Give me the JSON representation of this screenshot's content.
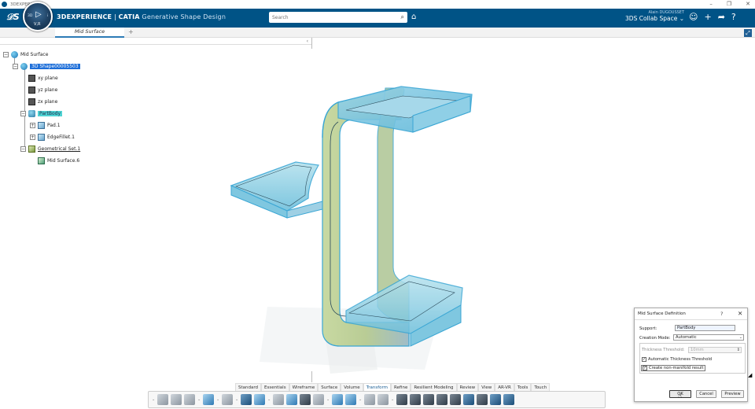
{
  "os": {
    "title": "3DEXPERIENCE",
    "minimize": "–",
    "restore": "❐",
    "close": "✕"
  },
  "header": {
    "brand_main": "3DEXPERIENCE",
    "brand_sep": " | ",
    "brand_product": "CATIA",
    "brand_app": "Generative Shape Design",
    "compass_version": "V,R",
    "search_placeholder": "Search",
    "user_name": "Alain DUGOUSSET",
    "collab_space": "3DS Collab Space",
    "collab_chevron": "⌄",
    "icons": [
      "user-icon",
      "add-icon",
      "share-icon",
      "help-icon"
    ]
  },
  "tabs": {
    "active": "Mid Surface",
    "add": "+"
  },
  "tree": {
    "root": "Mid Surface",
    "shape": "3D Shape00005503",
    "planes": [
      "xy plane",
      "yz plane",
      "zx plane"
    ],
    "part_body": "PartBody",
    "pad": "Pad.1",
    "edge_fillet": "EdgeFillet.1",
    "geo_set": "Geometrical Set.1",
    "mid_surface": "Mid Surface.6"
  },
  "sections": [
    "Standard",
    "Essentials",
    "Wireframe",
    "Surface",
    "Volume",
    "Transform",
    "Refine",
    "Resilient Modeling",
    "Review",
    "View",
    "AR-VR",
    "Tools",
    "Touch"
  ],
  "active_section": "Transform",
  "dialog": {
    "title": "Mid Surface Definition",
    "help": "?",
    "close": "✕",
    "support_label": "Support:",
    "support_value": "PartBody",
    "mode_label": "Creation Mode:",
    "mode_value": "Automatic",
    "thickness_label": "Thickness Threshold:",
    "thickness_value": "10mm",
    "auto_threshold": "Automatic Thickness Threshold",
    "non_manifold": "Create non-manifold result",
    "ok": "OK",
    "cancel": "Cancel",
    "preview": "Preview"
  }
}
